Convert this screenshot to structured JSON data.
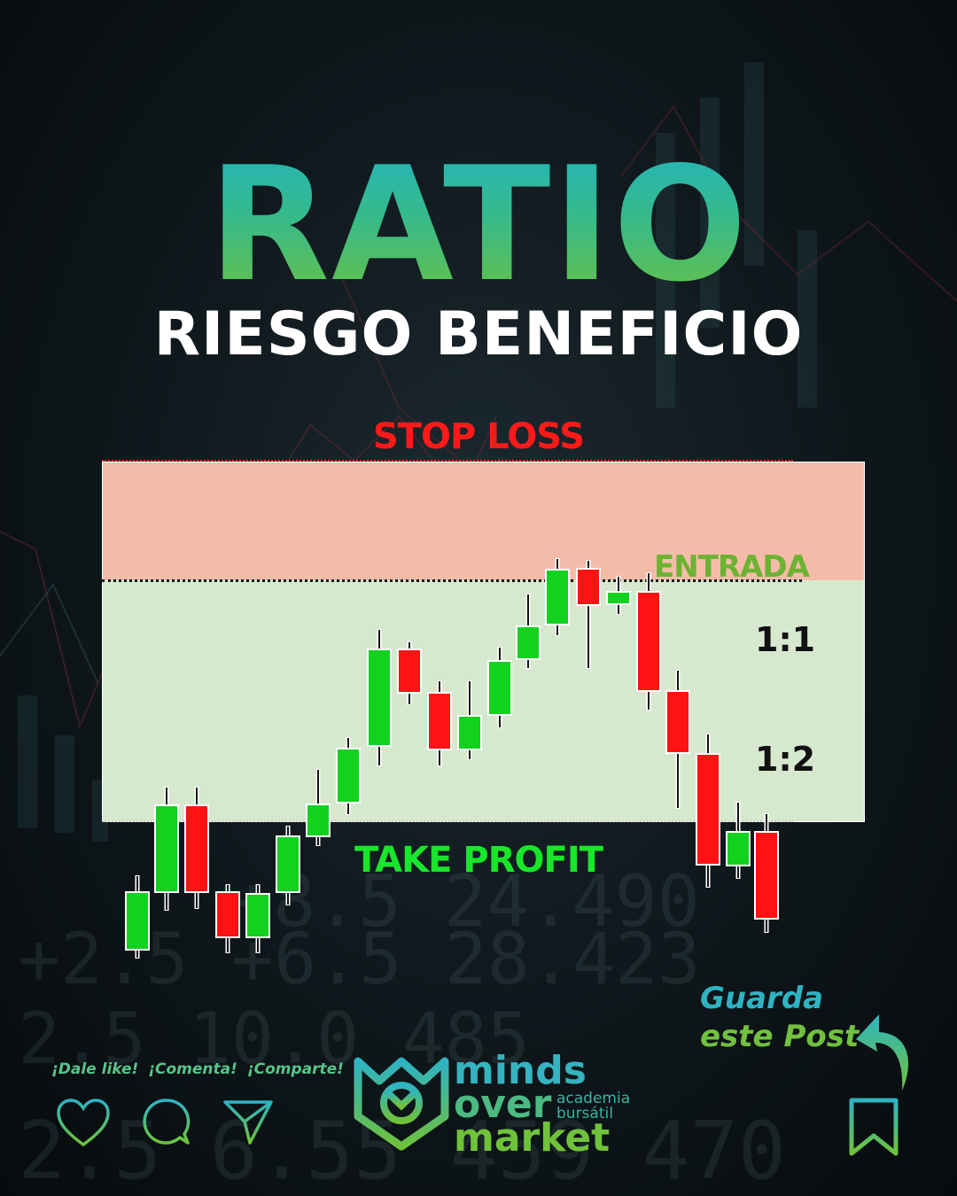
{
  "title": "RATIO",
  "subtitle": "RIESGO BENEFICIO",
  "labels": {
    "stop_loss": "STOP LOSS",
    "entry": "ENTRADA",
    "take_profit": "TAKE PROFIT",
    "ratio_1": "1:1",
    "ratio_2": "1:2"
  },
  "social": {
    "like": "¡Dale like!",
    "comment": "¡Comenta!",
    "share": "¡Comparte!"
  },
  "save_cta": {
    "line1": "Guarda",
    "line2": "este Post"
  },
  "brand": {
    "line1": "minds",
    "line2": "over",
    "line3": "market",
    "sub1": "academia",
    "sub2": "bursátil"
  },
  "colors": {
    "bull": "#12d11f",
    "bear": "#ff1212",
    "risk_zone": "#f4bca8",
    "reward_zone": "#d6e9cf",
    "title_gradient_top": "#21b3c4",
    "title_gradient_bottom": "#6fc23a"
  },
  "icons": [
    "heart-icon",
    "comment-icon",
    "send-icon",
    "share-arrow-icon",
    "bookmark-icon",
    "brand-logo-icon"
  ]
}
